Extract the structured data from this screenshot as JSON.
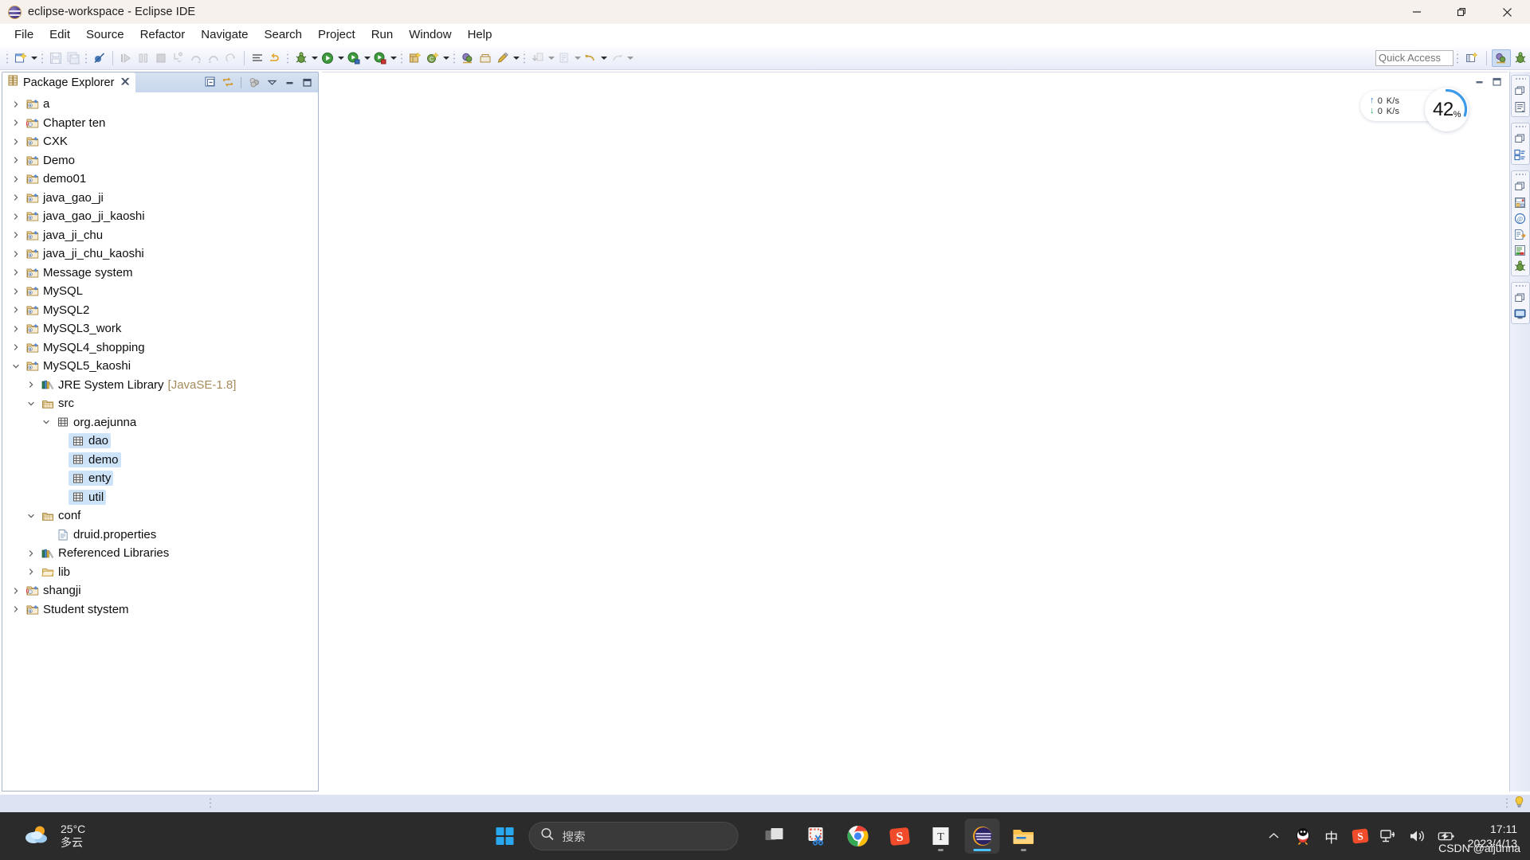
{
  "window": {
    "title": "eclipse-workspace - Eclipse IDE",
    "app_icon": "eclipse-icon",
    "minimize_label": "Minimize",
    "restore_label": "Restore",
    "close_label": "Close"
  },
  "menubar": {
    "items": [
      {
        "label": "File"
      },
      {
        "label": "Edit"
      },
      {
        "label": "Source"
      },
      {
        "label": "Refactor"
      },
      {
        "label": "Navigate"
      },
      {
        "label": "Search"
      },
      {
        "label": "Project"
      },
      {
        "label": "Run"
      },
      {
        "label": "Window"
      },
      {
        "label": "Help"
      }
    ]
  },
  "toolbar": {
    "quick_access_placeholder": "Quick Access",
    "quick_access_value": "",
    "groups": [
      {
        "name": "new-group",
        "buttons": [
          "new-wizard-icon"
        ]
      },
      {
        "name": "save-group",
        "buttons": [
          "save-icon",
          "save-all-icon"
        ]
      },
      {
        "name": "marker-group",
        "buttons": [
          "toggle-breakpoint-icon"
        ]
      },
      {
        "name": "debug-control-group",
        "buttons": [
          "resume-icon",
          "suspend-icon",
          "terminate-icon",
          "step-into-icon",
          "step-over-icon",
          "step-return-icon",
          "drop-to-frame-icon"
        ]
      },
      {
        "name": "format-group",
        "buttons": [
          "open-task-icon",
          "skip-breakpoints-icon"
        ]
      },
      {
        "name": "debug-run-group",
        "buttons": [
          "debug-icon",
          "run-icon",
          "run-last-icon",
          "coverage-icon"
        ]
      },
      {
        "name": "new-artifact-group",
        "buttons": [
          "new-java-project-icon",
          "new-class-icon"
        ]
      },
      {
        "name": "search-group",
        "buttons": [
          "open-type-icon",
          "open-task-repository-icon",
          "annotation-icon"
        ]
      },
      {
        "name": "navigate-group",
        "buttons": [
          "previous-edit-icon",
          "next-annotation-icon",
          "back-icon",
          "forward-icon"
        ]
      }
    ],
    "perspective_buttons": [
      "open-perspective-icon",
      "java-perspective-icon",
      "debug-perspective-icon"
    ]
  },
  "package_explorer": {
    "tab_label": "Package Explorer",
    "tab_icon": "package-explorer-icon",
    "close_icon": "close-icon",
    "view_toolbar": [
      {
        "name": "collapse-all-icon"
      },
      {
        "name": "link-with-editor-icon"
      },
      {
        "name": "focus-on-active-task-icon"
      },
      {
        "name": "view-menu-icon"
      },
      {
        "name": "minimize-view-icon"
      },
      {
        "name": "maximize-view-icon"
      }
    ],
    "tree": [
      {
        "label": "a",
        "icon": "java-project-icon",
        "indent": 0,
        "twisty": "collapsed",
        "selected": false
      },
      {
        "label": "Chapter ten",
        "icon": "java-project-error-icon",
        "indent": 0,
        "twisty": "collapsed",
        "selected": false
      },
      {
        "label": "CXK",
        "icon": "java-project-icon",
        "indent": 0,
        "twisty": "collapsed",
        "selected": false
      },
      {
        "label": "Demo",
        "icon": "java-project-icon",
        "indent": 0,
        "twisty": "collapsed",
        "selected": false
      },
      {
        "label": "demo01",
        "icon": "java-project-icon",
        "indent": 0,
        "twisty": "collapsed",
        "selected": false
      },
      {
        "label": "java_gao_ji",
        "icon": "java-project-icon",
        "indent": 0,
        "twisty": "collapsed",
        "selected": false
      },
      {
        "label": "java_gao_ji_kaoshi",
        "icon": "java-project-icon",
        "indent": 0,
        "twisty": "collapsed",
        "selected": false
      },
      {
        "label": "java_ji_chu",
        "icon": "java-project-icon",
        "indent": 0,
        "twisty": "collapsed",
        "selected": false
      },
      {
        "label": "java_ji_chu_kaoshi",
        "icon": "java-project-icon",
        "indent": 0,
        "twisty": "collapsed",
        "selected": false
      },
      {
        "label": "Message system",
        "icon": "java-project-icon",
        "indent": 0,
        "twisty": "collapsed",
        "selected": false
      },
      {
        "label": "MySQL",
        "icon": "java-project-icon",
        "indent": 0,
        "twisty": "collapsed",
        "selected": false
      },
      {
        "label": "MySQL2",
        "icon": "java-project-icon",
        "indent": 0,
        "twisty": "collapsed",
        "selected": false
      },
      {
        "label": "MySQL3_work",
        "icon": "java-project-icon",
        "indent": 0,
        "twisty": "collapsed",
        "selected": false
      },
      {
        "label": "MySQL4_shopping",
        "icon": "java-project-icon",
        "indent": 0,
        "twisty": "collapsed",
        "selected": false
      },
      {
        "label": "MySQL5_kaoshi",
        "icon": "java-project-icon",
        "indent": 0,
        "twisty": "expanded",
        "selected": false
      },
      {
        "label": "JRE System Library",
        "suffix": "[JavaSE-1.8]",
        "icon": "library-icon",
        "indent": 1,
        "twisty": "collapsed",
        "selected": false
      },
      {
        "label": "src",
        "icon": "source-folder-icon",
        "indent": 1,
        "twisty": "expanded",
        "selected": false
      },
      {
        "label": "org.aejunna",
        "icon": "package-icon",
        "indent": 2,
        "twisty": "expanded",
        "selected": false
      },
      {
        "label": "dao",
        "icon": "package-icon",
        "indent": 3,
        "twisty": "none",
        "selected": true
      },
      {
        "label": "demo",
        "icon": "package-icon",
        "indent": 3,
        "twisty": "none",
        "selected": true
      },
      {
        "label": "enty",
        "icon": "package-icon",
        "indent": 3,
        "twisty": "none",
        "selected": true
      },
      {
        "label": "util",
        "icon": "package-icon",
        "indent": 3,
        "twisty": "none",
        "selected": true
      },
      {
        "label": "conf",
        "icon": "source-folder-icon",
        "indent": 1,
        "twisty": "expanded",
        "selected": false
      },
      {
        "label": "druid.properties",
        "icon": "file-icon",
        "indent": 2,
        "twisty": "none",
        "selected": false
      },
      {
        "label": "Referenced Libraries",
        "icon": "library-icon",
        "indent": 1,
        "twisty": "collapsed",
        "selected": false
      },
      {
        "label": "lib",
        "icon": "folder-icon",
        "indent": 1,
        "twisty": "collapsed",
        "selected": false
      },
      {
        "label": "shangji",
        "icon": "java-project-error-icon",
        "indent": 0,
        "twisty": "collapsed",
        "selected": false
      },
      {
        "label": "Student stystem",
        "icon": "java-project-icon",
        "indent": 0,
        "twisty": "collapsed",
        "selected": false
      }
    ]
  },
  "editor": {
    "empty": true,
    "minimize_icon": "minimize-icon",
    "maximize_icon": "maximize-icon"
  },
  "fast_view_bar": {
    "groups": [
      {
        "restore_icon": "restore-icon",
        "items": [
          {
            "name": "outline-view-icon"
          }
        ]
      },
      {
        "restore_icon": "restore-icon",
        "items": [
          {
            "name": "task-list-view-icon"
          }
        ]
      },
      {
        "restore_icon": "restore-icon",
        "items": [
          {
            "name": "servers-view-icon"
          },
          {
            "name": "snippets-view-icon"
          },
          {
            "name": "data-source-explorer-icon"
          },
          {
            "name": "console-view-icon"
          },
          {
            "name": "debug-view-icon"
          }
        ]
      },
      {
        "restore_icon": "restore-icon",
        "items": [
          {
            "name": "display-view-icon"
          }
        ]
      }
    ]
  },
  "status_bar": {
    "tip_icon": "lightbulb-icon"
  },
  "network_widget": {
    "upload_arrow": "↑",
    "upload_value": "0",
    "upload_unit": "K/s",
    "download_arrow": "↓",
    "download_value": "0",
    "download_unit": "K/s",
    "percent": "42",
    "percent_symbol": "%",
    "gauge_value": 42,
    "gauge_color": "#3d9ae8"
  },
  "taskbar": {
    "weather": {
      "icon": "partly-cloudy-icon",
      "temperature": "25°C",
      "condition": "多云"
    },
    "start_label": "Start",
    "search": {
      "icon": "search-icon",
      "placeholder": "搜索"
    },
    "apps": [
      {
        "name": "task-view-icon",
        "active": false,
        "running": false
      },
      {
        "name": "snipping-tool-icon",
        "active": false,
        "running": false
      },
      {
        "name": "google-chrome-icon",
        "active": false,
        "running": false
      },
      {
        "name": "sogou-input-icon",
        "active": false,
        "running": false
      },
      {
        "name": "typora-icon",
        "active": false,
        "running": true
      },
      {
        "name": "eclipse-icon",
        "active": true,
        "running": true
      },
      {
        "name": "file-explorer-icon",
        "active": false,
        "running": true
      }
    ],
    "tray": [
      {
        "name": "show-hidden-icons-chevron-icon"
      },
      {
        "name": "qq-icon"
      },
      {
        "name": "ime-chinese-icon",
        "label": "中"
      },
      {
        "name": "sogou-pinyin-icon"
      },
      {
        "name": "network-icon"
      },
      {
        "name": "volume-icon"
      },
      {
        "name": "battery-icon"
      }
    ],
    "clock": {
      "time": "17:11",
      "date": "2023/4/13"
    },
    "watermark": "CSDN @aijunna"
  }
}
